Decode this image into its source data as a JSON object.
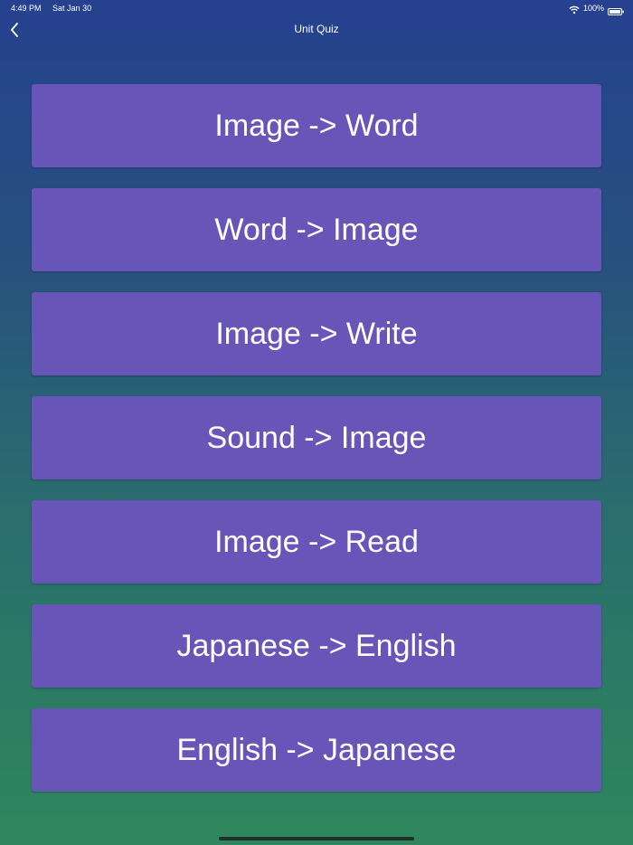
{
  "status_bar": {
    "time": "4:49 PM",
    "date": "Sat Jan 30",
    "battery": "100%",
    "wifi_icon": "wifi-icon",
    "battery_icon": "battery-full-icon"
  },
  "nav": {
    "title": "Unit Quiz",
    "back_icon": "chevron-left-icon"
  },
  "quiz_options": [
    {
      "label": "Image -> Word"
    },
    {
      "label": "Word -> Image"
    },
    {
      "label": "Image -> Write"
    },
    {
      "label": "Sound -> Image"
    },
    {
      "label": "Image -> Read"
    },
    {
      "label": "Japanese -> English"
    },
    {
      "label": "English -> Japanese"
    }
  ],
  "colors": {
    "button_background": "#6756b8",
    "gradient_top": "#26418f",
    "gradient_bottom": "#2e875c",
    "text": "#ffffff"
  }
}
